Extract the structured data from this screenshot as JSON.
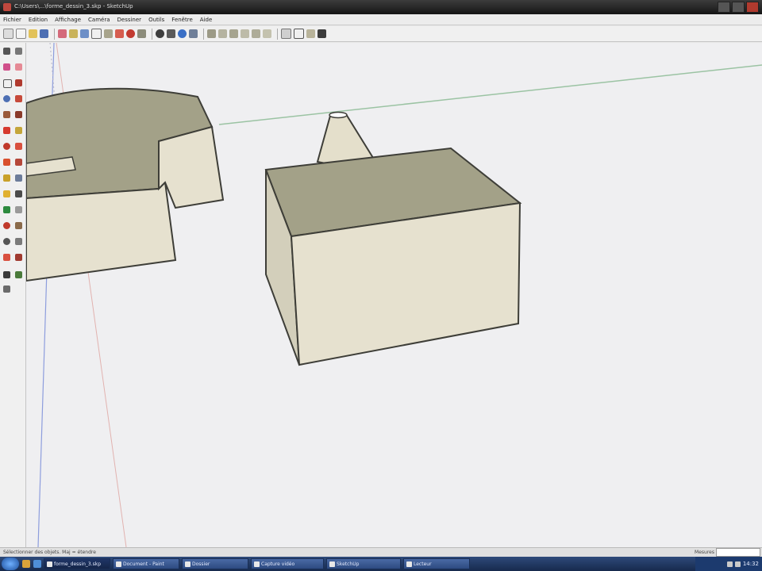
{
  "window": {
    "title": "C:\\Users\\...\\forme_dessin_3.skp - SketchUp"
  },
  "menu": {
    "items": [
      "Fichier",
      "Edition",
      "Affichage",
      "Caméra",
      "Dessiner",
      "Outils",
      "Fenêtre",
      "Aide"
    ]
  },
  "colors": {
    "face_top": "#a3a188",
    "face_front": "#e6e1cf",
    "face_side": "#d3cfbb",
    "edge": "#3e3e38",
    "axis_green": "#9bc3a3",
    "axis_blue": "#8d9ddd",
    "axis_red": "#d98a84"
  },
  "status": {
    "hint": "Sélectionner des objets. Maj = étendre",
    "vcb_label": "Mesures"
  },
  "taskbar": {
    "tasks": [
      "forme_dessin_3.skp",
      "Document - Paint",
      "Dossier",
      "Capture vidéo",
      "SketchUp",
      "Lecteur"
    ],
    "clock": "14:32"
  }
}
